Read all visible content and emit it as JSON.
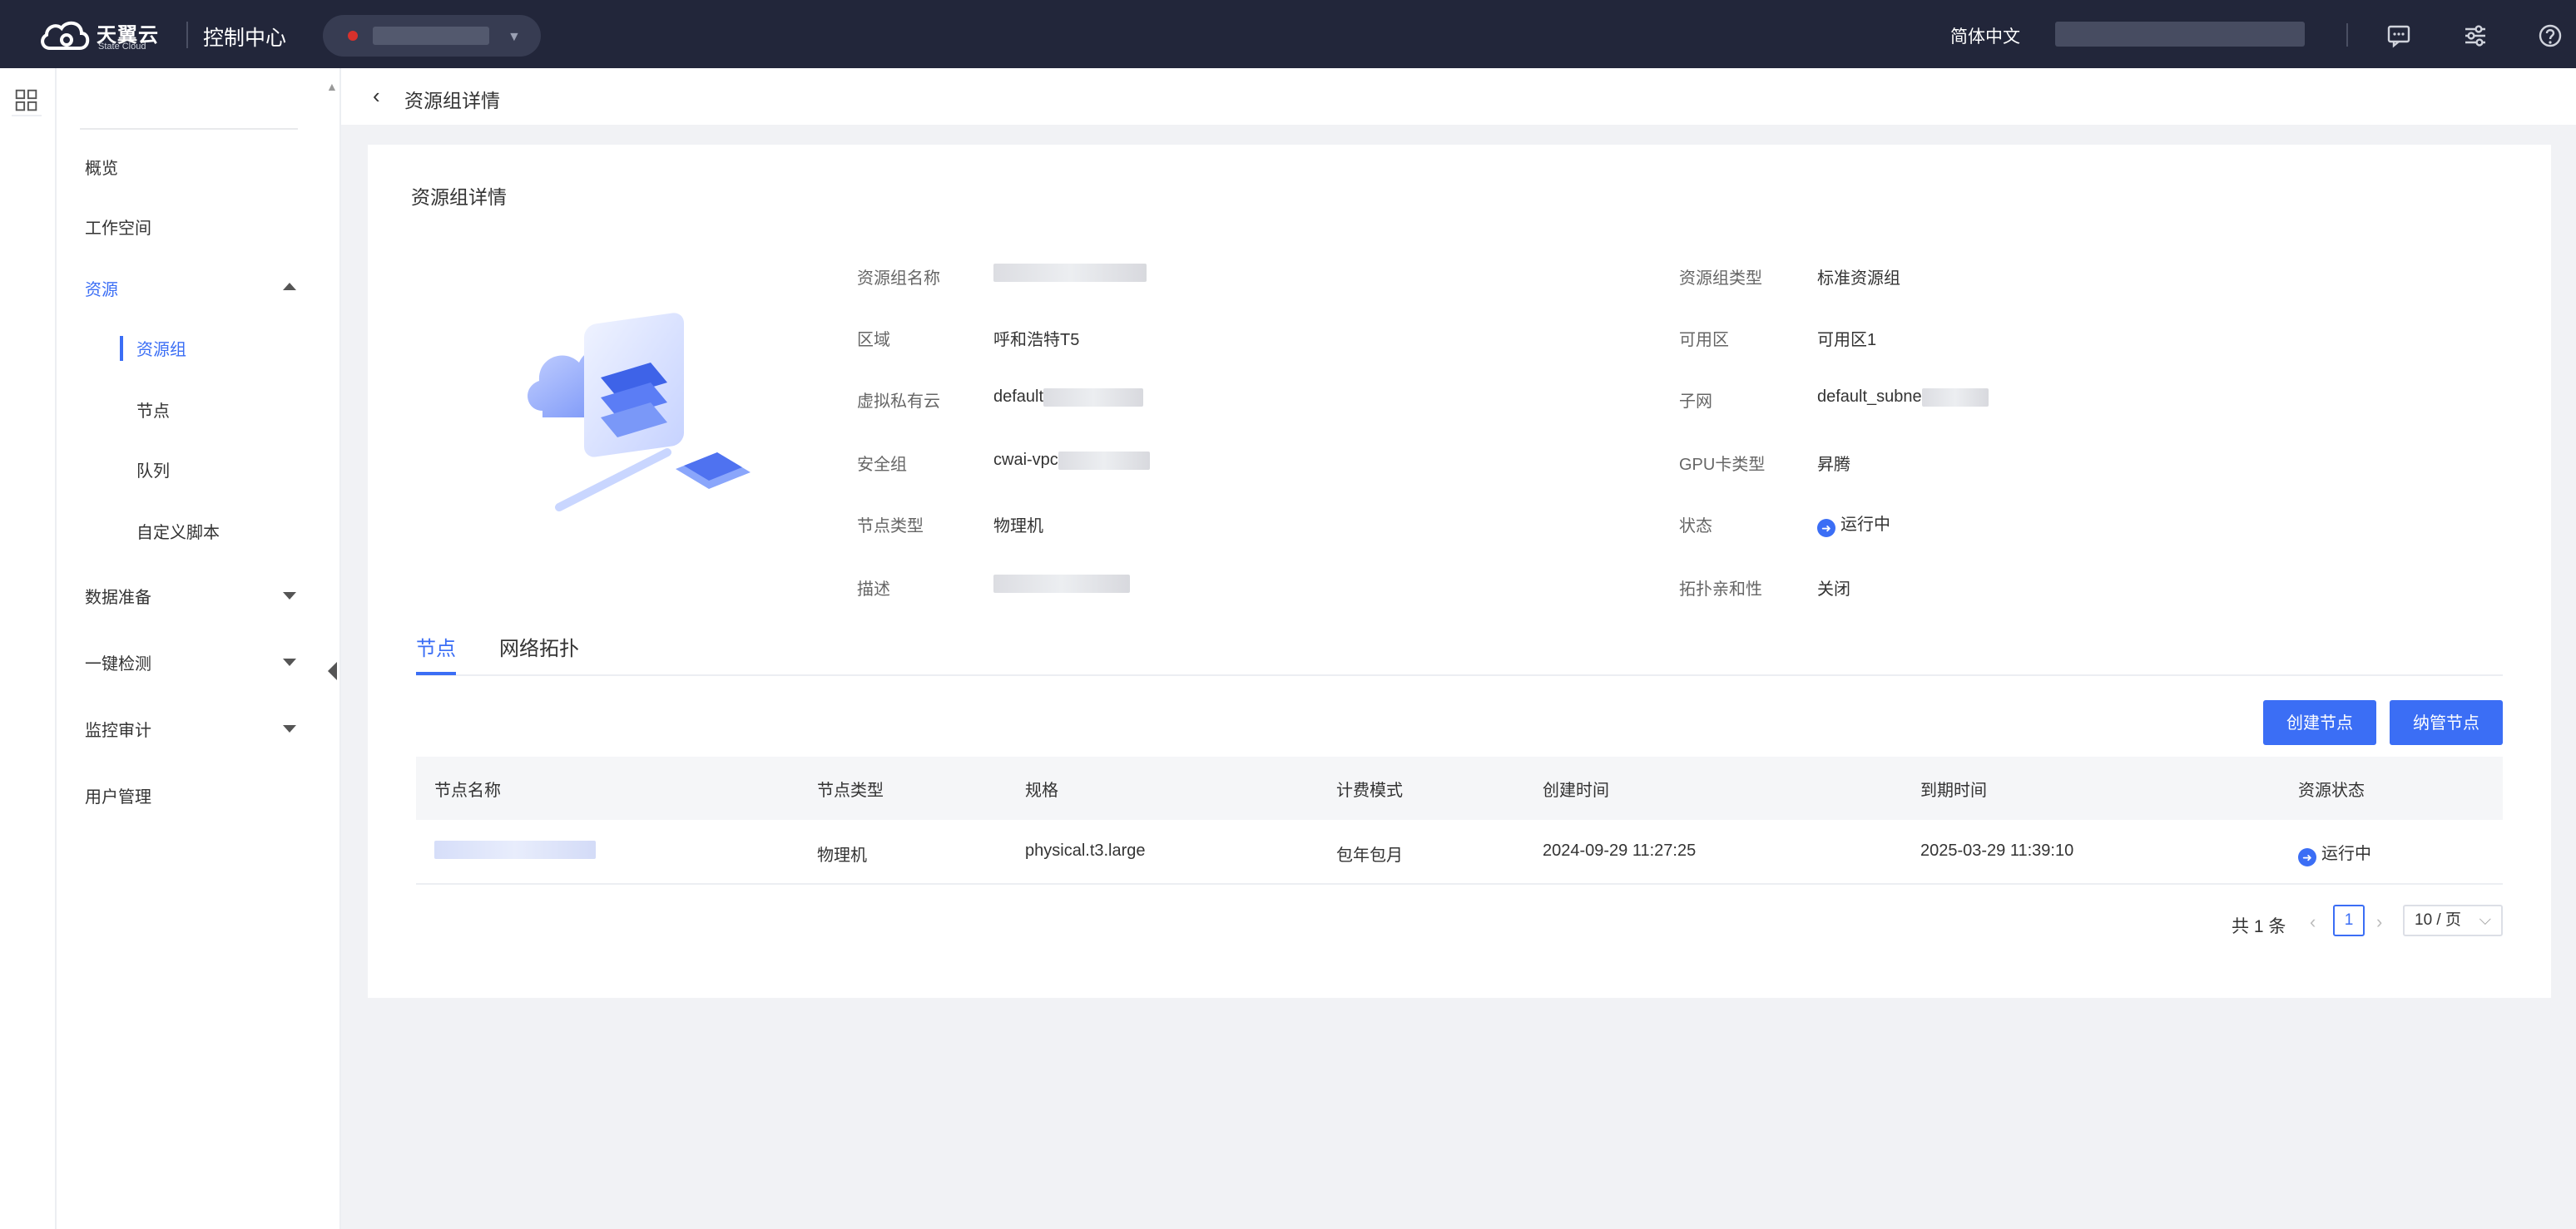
{
  "topbar": {
    "brand": "天翼云",
    "brand_sub": "State Cloud",
    "console": "控制中心",
    "language": "简体中文",
    "icons": [
      "cloud-logo-icon",
      "message-icon",
      "settings-sliders-icon",
      "help-icon"
    ]
  },
  "sidebar": {
    "items": [
      {
        "label": "概览"
      },
      {
        "label": "工作空间"
      },
      {
        "label": "资源"
      },
      {
        "label": "数据准备"
      },
      {
        "label": "一键检测"
      },
      {
        "label": "监控审计"
      },
      {
        "label": "用户管理"
      }
    ],
    "resource_children": [
      {
        "label": "资源组"
      },
      {
        "label": "节点"
      },
      {
        "label": "队列"
      },
      {
        "label": "自定义脚本"
      }
    ]
  },
  "page_header": {
    "back_icon": "chevron-left-icon",
    "title": "资源组详情"
  },
  "card": {
    "title": "资源组详情",
    "fields_left": [
      {
        "label": "资源组名称",
        "value": ""
      },
      {
        "label": "区域",
        "value": "呼和浩特T5"
      },
      {
        "label": "虚拟私有云",
        "value": "default"
      },
      {
        "label": "安全组",
        "value": "cwai-vpc"
      },
      {
        "label": "节点类型",
        "value": "物理机"
      },
      {
        "label": "描述",
        "value": ""
      }
    ],
    "fields_right": [
      {
        "label": "资源组类型",
        "value": "标准资源组"
      },
      {
        "label": "可用区",
        "value": "可用区1"
      },
      {
        "label": "子网",
        "value": "default_subne"
      },
      {
        "label": "GPU卡类型",
        "value": "昇腾"
      },
      {
        "label": "状态",
        "value": "运行中"
      },
      {
        "label": "拓扑亲和性",
        "value": "关闭"
      }
    ]
  },
  "tabs": [
    {
      "label": "节点"
    },
    {
      "label": "网络拓扑"
    }
  ],
  "buttons": {
    "create_node": "创建节点",
    "manage_node": "纳管节点"
  },
  "table": {
    "headers": [
      "节点名称",
      "节点类型",
      "规格",
      "计费模式",
      "创建时间",
      "到期时间",
      "资源状态"
    ],
    "rows": [
      [
        "",
        "物理机",
        "physical.t3.large",
        "包年包月",
        "2024-09-29 11:27:25",
        "2025-03-29 11:39:10",
        "运行中"
      ]
    ]
  },
  "pagination": {
    "total": "共 1 条",
    "page": "1",
    "page_size": "10 / 页"
  },
  "colors": {
    "accent": "#3b6ef5",
    "topbar": "#22263a",
    "background": "#f1f2f5"
  }
}
